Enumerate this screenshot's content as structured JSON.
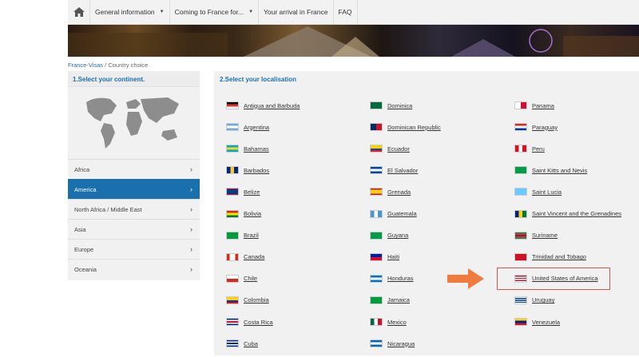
{
  "nav": {
    "items": [
      {
        "label": "General information",
        "caret": true
      },
      {
        "label": "Coming to France for...",
        "caret": true
      },
      {
        "label": "Your arrival in France",
        "caret": false
      },
      {
        "label": "FAQ",
        "caret": false
      }
    ]
  },
  "breadcrumb": {
    "link": "France-Visas",
    "separator": " / ",
    "current": "Country choice"
  },
  "left": {
    "title": "1.Select your continent.",
    "continents": [
      {
        "label": "Africa",
        "active": false
      },
      {
        "label": "America",
        "active": true
      },
      {
        "label": "North Africa / Middle East",
        "active": false
      },
      {
        "label": "Asia",
        "active": false
      },
      {
        "label": "Europe",
        "active": false
      },
      {
        "label": "Oceania",
        "active": false
      }
    ]
  },
  "right": {
    "title": "2.Select your localisation",
    "columns": [
      [
        "Antigua and Barbuda",
        "Argentina",
        "Bahamas",
        "Barbados",
        "Belize",
        "Bolivia",
        "Brazil",
        "Canada",
        "Chile",
        "Colombia",
        "Costa Rica",
        "Cuba"
      ],
      [
        "Dominica",
        "Dominican Republic",
        "Ecuador",
        "El Salvador",
        "Grenada",
        "Guatemala",
        "Guyana",
        "Haiti",
        "Honduras",
        "Jamaica",
        "Mexico",
        "Nicaragua"
      ],
      [
        "Panama",
        "Paraguay",
        "Peru",
        "Saint Kitts and Nevis",
        "Saint Lucia",
        "Saint Vincent and the Grenadines",
        "Suriname",
        "Trinidad and Tobago",
        "United States of America",
        "Uruguay",
        "Venezuela"
      ]
    ]
  },
  "colors": {
    "accent": "#1a6fad",
    "highlight": "#d9534f",
    "arrow": "#f07b3f"
  }
}
